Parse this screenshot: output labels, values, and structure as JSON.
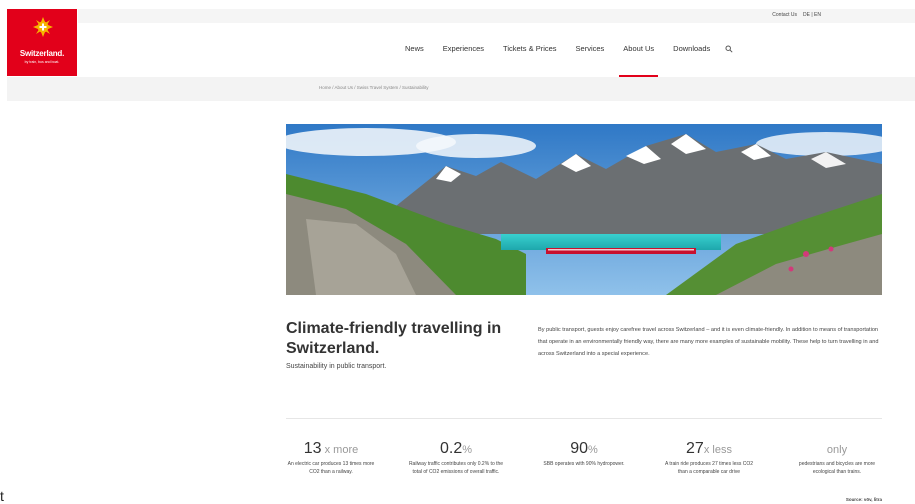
{
  "header": {
    "contact": "Contact Us",
    "lang_de": "DE",
    "lang_sep": "|",
    "lang_en": "EN",
    "logo_wordmark": "Switzerland.",
    "logo_tagline": "by train, bus and boat."
  },
  "nav": {
    "items": [
      "News",
      "Experiences",
      "Tickets & Prices",
      "Services",
      "About Us",
      "Downloads"
    ],
    "active": "About Us",
    "search_icon": "search-icon"
  },
  "breadcrumb": "Home / About Us / Swiss Travel System / Sustainability",
  "content": {
    "title": "Climate-friendly travelling in Switzerland.",
    "subtitle": "Sustainability in public transport.",
    "intro": "By public transport, guests enjoy carefree travel across Switzerland – and it is even climate-friendly. In addition to means of transportation that operate in an environmentally friendly way, there are many more examples of sustainable mobility. These help to turn travelling in and across Switzerland into a special experience."
  },
  "stats": [
    {
      "value": "13",
      "unit": " x more",
      "desc": "An electric car produces 13 times more CO2 than a railway."
    },
    {
      "value": "0.2",
      "unit": "%",
      "desc": "Railway traffic contributes only 0.2% to the total of CO2 emissions of overall traffic."
    },
    {
      "value": "90",
      "unit": "%",
      "desc": "SBB operates with 90% hydropower."
    },
    {
      "value": "27",
      "unit": "x less",
      "desc": "A train ride produces 27 times less CO2 than a comparable car drive"
    },
    {
      "value": "",
      "unit": "only",
      "desc": "pedestrians and bicycles are more ecological than trains."
    }
  ],
  "source": "Source: vöv, litra",
  "stray_char": "t",
  "colors": {
    "brand_red": "#e2001a",
    "lake": "#2fc6c6",
    "sky": "#3d86cf"
  }
}
